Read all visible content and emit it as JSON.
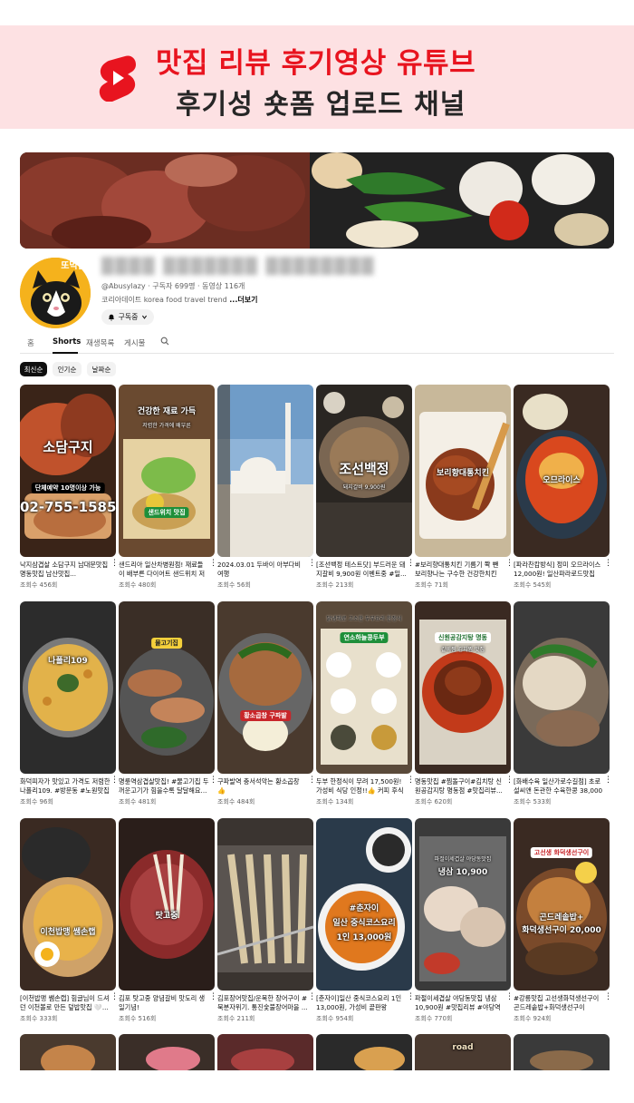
{
  "promo": {
    "line1": "맛집 리뷰 후기영상 유튜브",
    "line2": "후기성 숏폼 업로드 채널",
    "logo_icon": "youtube-shorts-icon",
    "accent": "#e8141f",
    "band_color": "#fde1e3"
  },
  "channel": {
    "avatar_tag": "또먹남",
    "name": "████ ███████ ████████",
    "handle": "@Abusylazy",
    "subscribers": "구독자 699명",
    "videos": "동영상 116개",
    "description": "코리아데이트 korea food travel trend ",
    "more": "...더보기",
    "subscribe_label": "구독중"
  },
  "tabs": [
    "홈",
    "Shorts",
    "재생목록",
    "게시물"
  ],
  "active_tab": "Shorts",
  "chips": [
    "최신순",
    "인기순",
    "날짜순"
  ],
  "active_chip": "최신순",
  "videos": [
    {
      "title": "낙지삼겹살 소담구지 남대문맛집 명동맛집 남산맛집...",
      "views": "조회수 456회",
      "overlay": "소담구지",
      "overlay2": "02-755-1585",
      "overlay3": "단체예약 10명이상 가능"
    },
    {
      "title": "샌드리아 일산차병원점! 재료들이 배부른 다이어트 샌드위치 저렴...",
      "views": "조회수 480회",
      "overlay": "건강한 재료 가득",
      "overlay2": "샌드위치 맛집",
      "overlay3": "저렴한 가격에 배부른"
    },
    {
      "title": "2024.03.01 두바이 아부다비 여행",
      "views": "조회수 56회",
      "overlay": "",
      "overlay2": "",
      "overlay3": ""
    },
    {
      "title": "[조선백정 테스트닷] 부드러운 돼지갈비 9,900원 이벤트중 #일...",
      "views": "조회수 213회",
      "overlay": "조선백정",
      "overlay2": "돼지갈비 9,900원",
      "overlay3": ""
    },
    {
      "title": "#보리향대통치킨 기름기 쫙 뺀 보리향나는 구수한 건강한치킨 #...",
      "views": "조회수 71회",
      "overlay": "보리향대통치킨",
      "overlay2": "",
      "overlay3": ""
    },
    {
      "title": "[파라찬캄방식] 정미 오므라이스 12,000원! 일산파라로드맛집 #...",
      "views": "조회수 545회",
      "overlay": "오므라이스",
      "overlay2": "",
      "overlay3": ""
    },
    {
      "title": "화덕피자가 맛있고 가격도 저렴한 나폴리109. #방문동 #노원맛집",
      "views": "조회수 96회",
      "overlay": "나폴리109",
      "overlay2": "",
      "overlay3": ""
    },
    {
      "title": "명륜역삼겹살맛집! #물고기집 두꺼운고기가 힘을수록 달달해요...",
      "views": "조회수 481회",
      "overlay": "물고기집",
      "overlay2": "",
      "overlay3": ""
    },
    {
      "title": "구파발역 충서석악는 황소곱창 👍",
      "views": "조회수 484회",
      "overlay": "황소곱창 구파발",
      "overlay2": "",
      "overlay3": ""
    },
    {
      "title": "두부 한정식이 무려 17,500원! 가성비 식당 인정!!👍 커피 후식까...",
      "views": "조회수 134회",
      "overlay": "연소하늘콩두부",
      "overlay2": "",
      "overlay3": "닭냉채로 고소한 두부요리 한정식"
    },
    {
      "title": "명동맛집 #찜돌구이#김치탕 신원공감지탕 명동점 #맛집리뷰...",
      "views": "조회수 620회",
      "overlay": "신원공감지탕 명동",
      "overlay2": "",
      "overlay3": "갈비찜 김치찜 맛집"
    },
    {
      "title": "[화배수육 일산가로수길점] 초로설씨앤 돈관한 수육한콩 38,000원...",
      "views": "조회수 533회",
      "overlay": "",
      "overlay2": "",
      "overlay3": ""
    },
    {
      "title": "[이천밥맹 쌤손랩] 힘글님이 드셔던 이천볼로 만든 덮밥맛집 🤍...",
      "views": "조회수 333회",
      "overlay": "이천밥맹 쌤손랩",
      "overlay2": "",
      "overlay3": ""
    },
    {
      "title": "김포 탓고중 양념갈비 맛도리 생일기념!",
      "views": "조회수 516회",
      "overlay": "탓고중",
      "overlay2": "",
      "overlay3": ""
    },
    {
      "title": "김포장어맛집/운복한 장어구이 #북분자위기. 통진숯불장어마을 ...",
      "views": "조회수 211회",
      "overlay": "",
      "overlay2": "",
      "overlay3": ""
    },
    {
      "title": "[춘자이]일산 중식코스요리 1인 13,000원, 가성비 끝판왕",
      "views": "조회수 954회",
      "overlay": "#춘자이",
      "overlay2": "일산 중식코스요리",
      "overlay3": "1인 13,000원"
    },
    {
      "title": "파절이세겹살 야당동맛집 냉삼 10,900원 #맛집리뷰 #야당역맛...",
      "views": "조회수 770회",
      "overlay": "냉삼 10,900",
      "overlay2": "",
      "overlay3": "파절이세겹살 야당동맛집"
    },
    {
      "title": "#강릉맛집 고선생화덕생선구이 곤드레솥밥+화덕생선구이 20,000...",
      "views": "조회수 924회",
      "overlay": "고선생 화덕생선구이",
      "overlay2": "곤드레솥밥+",
      "overlay3": "화덕생선구이 20,000"
    }
  ],
  "partial_row": [
    "",
    "",
    "",
    "",
    "road",
    ""
  ]
}
